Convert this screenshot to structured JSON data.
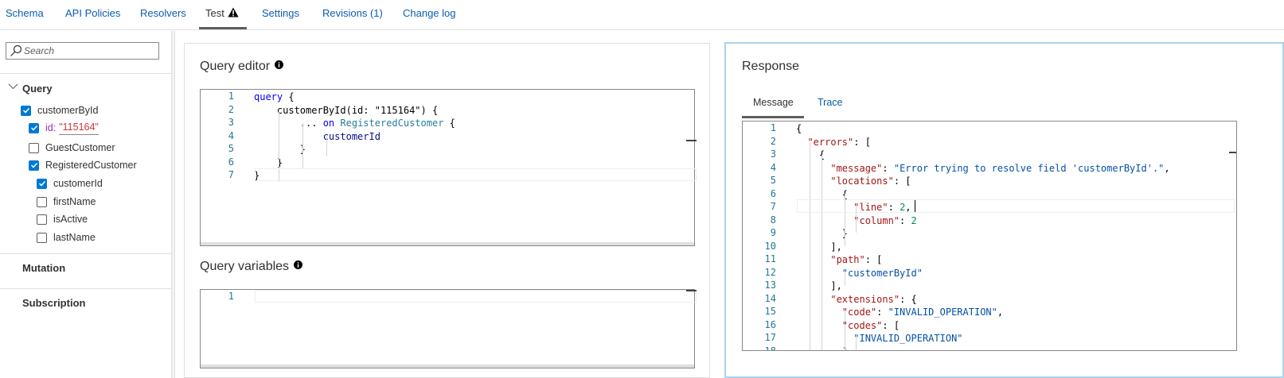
{
  "tabs": [
    {
      "label": "Schema"
    },
    {
      "label": "API Policies"
    },
    {
      "label": "Resolvers"
    },
    {
      "label": "Test",
      "icon": "warning-icon",
      "active": true
    },
    {
      "label": "Settings"
    },
    {
      "label": "Revisions (1)"
    },
    {
      "label": "Change log"
    }
  ],
  "sidebar": {
    "search_placeholder": "Search",
    "query_header": "Query",
    "items": [
      {
        "label": "customerById",
        "checked": true
      },
      {
        "arg_name": "id:",
        "arg_value": "\"115164\"",
        "checked": true
      },
      {
        "label": "GuestCustomer",
        "checked": false
      },
      {
        "label": "RegisteredCustomer",
        "checked": true
      },
      {
        "label": "customerId",
        "checked": true
      },
      {
        "label": "firstName",
        "checked": false
      },
      {
        "label": "isActive",
        "checked": false
      },
      {
        "label": "lastName",
        "checked": false
      }
    ],
    "mutation_header": "Mutation",
    "subscription_header": "Subscription"
  },
  "query_editor": {
    "title": "Query editor",
    "lines": [
      [
        {
          "t": "query",
          "c": "kw"
        },
        {
          "t": " {",
          "c": "punc"
        }
      ],
      [
        {
          "t": "    customerById(id: ",
          "c": "plain"
        },
        {
          "t": "\"115164\"",
          "c": "plain"
        },
        {
          "t": ") {",
          "c": "plain"
        }
      ],
      [
        {
          "t": "        ... ",
          "c": "plain"
        },
        {
          "t": "on",
          "c": "kw"
        },
        {
          "t": " ",
          "c": "plain"
        },
        {
          "t": "RegisteredCustomer",
          "c": "ty"
        },
        {
          "t": " {",
          "c": "plain"
        }
      ],
      [
        {
          "t": "            customerId",
          "c": "pr"
        }
      ],
      [
        {
          "t": "        }",
          "c": "plain"
        }
      ],
      [
        {
          "t": "    }",
          "c": "plain"
        }
      ],
      [
        {
          "t": "}",
          "c": "plain"
        }
      ]
    ]
  },
  "query_variables": {
    "title": "Query variables",
    "lines": [
      [
        {
          "t": "",
          "c": "plain"
        }
      ]
    ]
  },
  "response": {
    "title": "Response",
    "tabs": [
      {
        "label": "Message",
        "active": true
      },
      {
        "label": "Trace",
        "active": false
      }
    ],
    "lines": [
      [
        {
          "t": "{",
          "c": "plain"
        }
      ],
      [
        {
          "t": "  ",
          "c": "plain"
        },
        {
          "t": "\"errors\"",
          "c": "str"
        },
        {
          "t": ": [",
          "c": "plain"
        }
      ],
      [
        {
          "t": "    {",
          "c": "plain"
        }
      ],
      [
        {
          "t": "      ",
          "c": "plain"
        },
        {
          "t": "\"message\"",
          "c": "str"
        },
        {
          "t": ": ",
          "c": "plain"
        },
        {
          "t": "\"Error trying to resolve field 'customerById'.\"",
          "c": "str2"
        },
        {
          "t": ",",
          "c": "plain"
        }
      ],
      [
        {
          "t": "      ",
          "c": "plain"
        },
        {
          "t": "\"locations\"",
          "c": "str"
        },
        {
          "t": ": [",
          "c": "plain"
        }
      ],
      [
        {
          "t": "        {",
          "c": "plain"
        }
      ],
      [
        {
          "t": "          ",
          "c": "plain"
        },
        {
          "t": "\"line\"",
          "c": "str"
        },
        {
          "t": ": ",
          "c": "plain"
        },
        {
          "t": "2",
          "c": "num"
        },
        {
          "t": ",",
          "c": "plain"
        }
      ],
      [
        {
          "t": "          ",
          "c": "plain"
        },
        {
          "t": "\"column\"",
          "c": "str"
        },
        {
          "t": ": ",
          "c": "plain"
        },
        {
          "t": "2",
          "c": "num"
        }
      ],
      [
        {
          "t": "        }",
          "c": "plain"
        }
      ],
      [
        {
          "t": "      ],",
          "c": "plain"
        }
      ],
      [
        {
          "t": "      ",
          "c": "plain"
        },
        {
          "t": "\"path\"",
          "c": "str"
        },
        {
          "t": ": [",
          "c": "plain"
        }
      ],
      [
        {
          "t": "        ",
          "c": "plain"
        },
        {
          "t": "\"customerById\"",
          "c": "str2"
        }
      ],
      [
        {
          "t": "      ],",
          "c": "plain"
        }
      ],
      [
        {
          "t": "      ",
          "c": "plain"
        },
        {
          "t": "\"extensions\"",
          "c": "str"
        },
        {
          "t": ": {",
          "c": "plain"
        }
      ],
      [
        {
          "t": "        ",
          "c": "plain"
        },
        {
          "t": "\"code\"",
          "c": "str"
        },
        {
          "t": ": ",
          "c": "plain"
        },
        {
          "t": "\"INVALID_OPERATION\"",
          "c": "str2"
        },
        {
          "t": ",",
          "c": "plain"
        }
      ],
      [
        {
          "t": "        ",
          "c": "plain"
        },
        {
          "t": "\"codes\"",
          "c": "str"
        },
        {
          "t": ": [",
          "c": "plain"
        }
      ],
      [
        {
          "t": "          ",
          "c": "plain"
        },
        {
          "t": "\"INVALID_OPERATION\"",
          "c": "str2"
        }
      ],
      [
        {
          "t": "        ]",
          "c": "plain"
        }
      ]
    ]
  },
  "colors": {
    "link": "#0a5ead",
    "checkbox": "#0078d4",
    "focus_border": "#a9d3f0",
    "line_number": "#237893"
  }
}
